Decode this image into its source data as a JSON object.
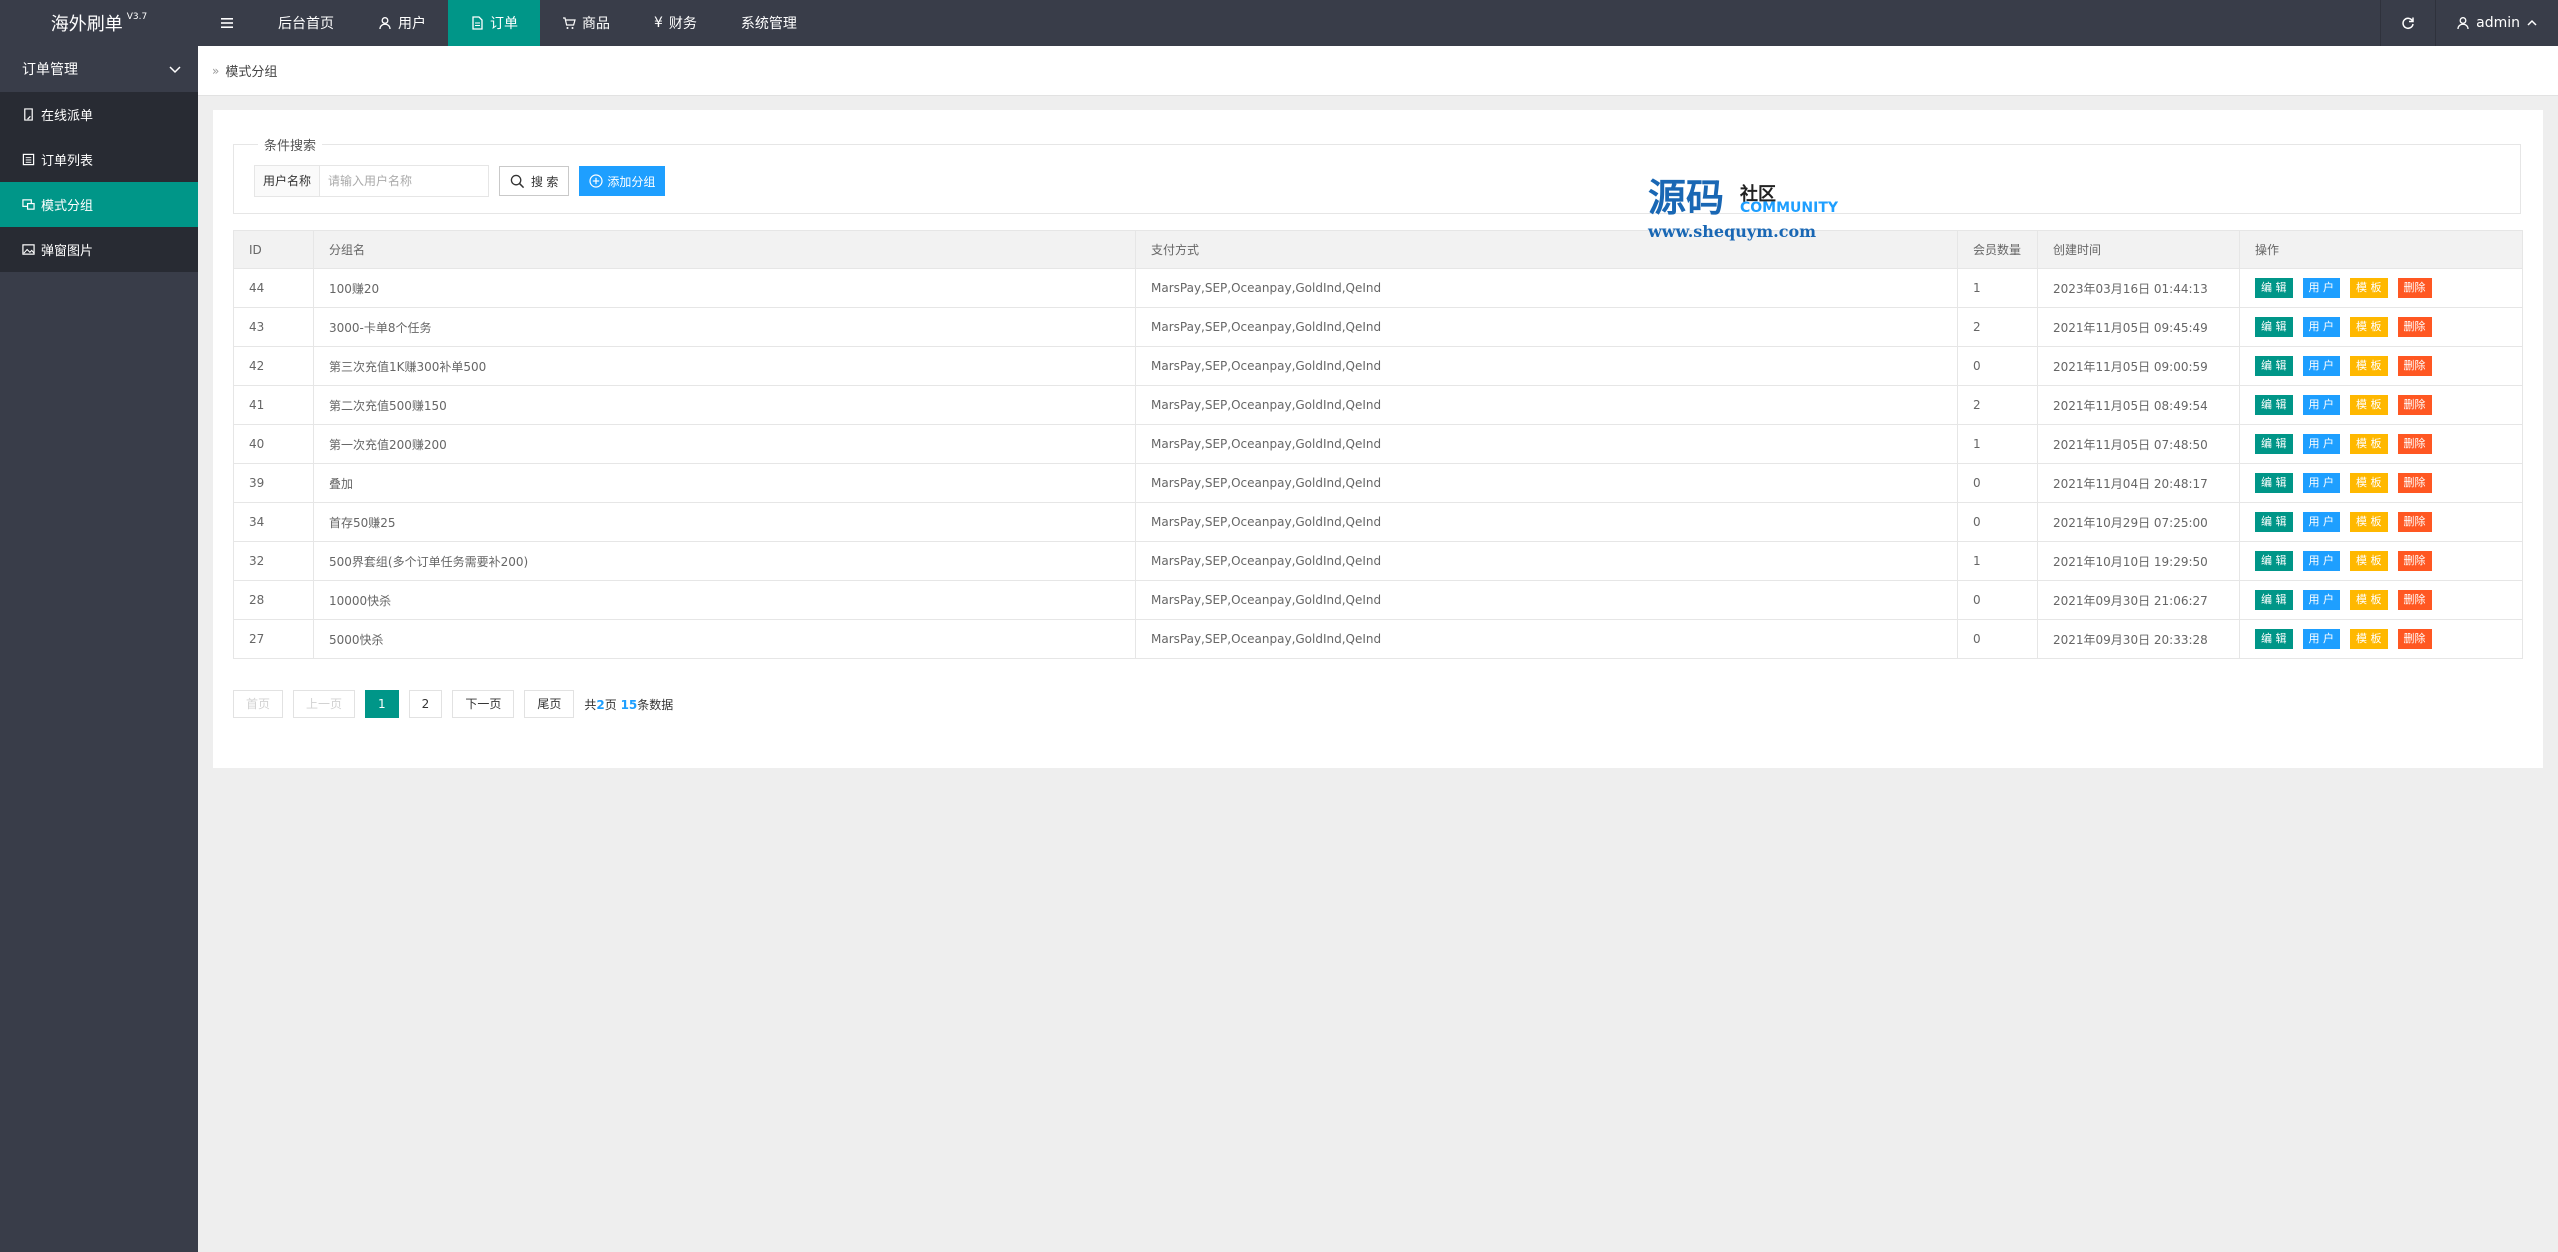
{
  "app": {
    "title": "海外刷单",
    "version": "V3.7"
  },
  "topnav": [
    {
      "label": "",
      "icon": "menu-icon"
    },
    {
      "label": "后台首页",
      "icon": ""
    },
    {
      "label": "用户",
      "icon": "user-icon"
    },
    {
      "label": "订单",
      "icon": "document-icon"
    },
    {
      "label": "商品",
      "icon": "cart-icon"
    },
    {
      "label": "财务",
      "icon": "yen-icon"
    },
    {
      "label": "系统管理",
      "icon": ""
    }
  ],
  "topright": {
    "refresh_icon": "refresh-icon",
    "user": "admin"
  },
  "sidebar": {
    "group": "订单管理",
    "items": [
      {
        "label": "在线派单",
        "icon": "note-icon"
      },
      {
        "label": "订单列表",
        "icon": "list-icon"
      },
      {
        "label": "模式分组",
        "icon": "group-icon"
      },
      {
        "label": "弹窗图片",
        "icon": "image-icon"
      }
    ]
  },
  "breadcrumb": "模式分组",
  "search": {
    "legend": "条件搜索",
    "label": "用户名称",
    "placeholder": "请输入用户名称",
    "search_btn": "搜 索",
    "add_btn": "添加分组"
  },
  "watermark": {
    "big": "源码",
    "small1": "社区",
    "small2": "COMMUNITY",
    "url": "www.shequym.com"
  },
  "table": {
    "columns": [
      "ID",
      "分组名",
      "支付方式",
      "会员数量",
      "创建时间",
      "操作"
    ],
    "actions": [
      "编 辑",
      "用 户",
      "模 板",
      "删除"
    ],
    "rows": [
      {
        "id": "44",
        "name": "100赚20",
        "pay": "MarsPay,SEP,Oceanpay,GoldInd,QeInd",
        "count": "1",
        "time": "2023年03月16日 01:44:13"
      },
      {
        "id": "43",
        "name": "3000-卡单8个任务",
        "pay": "MarsPay,SEP,Oceanpay,GoldInd,QeInd",
        "count": "2",
        "time": "2021年11月05日 09:45:49"
      },
      {
        "id": "42",
        "name": "第三次充值1K赚300补单500",
        "pay": "MarsPay,SEP,Oceanpay,GoldInd,QeInd",
        "count": "0",
        "time": "2021年11月05日 09:00:59"
      },
      {
        "id": "41",
        "name": "第二次充值500赚150",
        "pay": "MarsPay,SEP,Oceanpay,GoldInd,QeInd",
        "count": "2",
        "time": "2021年11月05日 08:49:54"
      },
      {
        "id": "40",
        "name": "第一次充值200赚200",
        "pay": "MarsPay,SEP,Oceanpay,GoldInd,QeInd",
        "count": "1",
        "time": "2021年11月05日 07:48:50"
      },
      {
        "id": "39",
        "name": "叠加",
        "pay": "MarsPay,SEP,Oceanpay,GoldInd,QeInd",
        "count": "0",
        "time": "2021年11月04日 20:48:17"
      },
      {
        "id": "34",
        "name": "首存50赚25",
        "pay": "MarsPay,SEP,Oceanpay,GoldInd,QeInd",
        "count": "0",
        "time": "2021年10月29日 07:25:00"
      },
      {
        "id": "32",
        "name": "500界套组(多个订单任务需要补200)",
        "pay": "MarsPay,SEP,Oceanpay,GoldInd,QeInd",
        "count": "1",
        "time": "2021年10月10日 19:29:50"
      },
      {
        "id": "28",
        "name": "10000快杀",
        "pay": "MarsPay,SEP,Oceanpay,GoldInd,QeInd",
        "count": "0",
        "time": "2021年09月30日 21:06:27"
      },
      {
        "id": "27",
        "name": "5000快杀",
        "pay": "MarsPay,SEP,Oceanpay,GoldInd,QeInd",
        "count": "0",
        "time": "2021年09月30日 20:33:28"
      }
    ]
  },
  "pagination": {
    "first": "首页",
    "prev": "上一页",
    "pages": [
      "1",
      "2"
    ],
    "current": "1",
    "next": "下一页",
    "last": "尾页",
    "info_prefix": "共",
    "total_pages": "2",
    "info_mid": "页",
    "total_items": "15",
    "info_suffix": "条数据"
  },
  "colors": {
    "accent": "#009688",
    "blue": "#1e9fff",
    "orange": "#ffb800",
    "red": "#ff5722",
    "dark": "#393d49"
  }
}
